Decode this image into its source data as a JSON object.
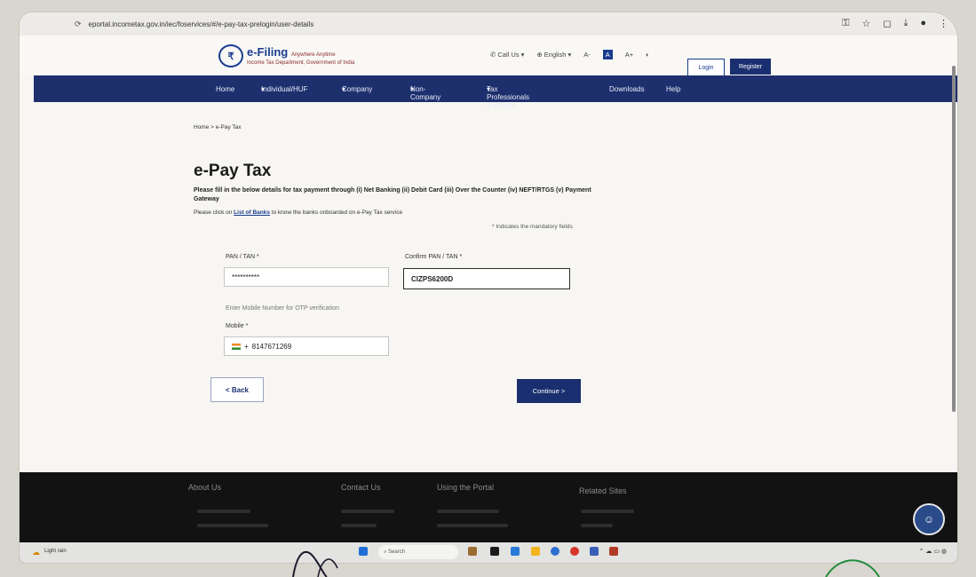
{
  "browser": {
    "url": "eportal.incometax.gov.in/iec/foservices/#/e-pay-tax-prelogin/user-details"
  },
  "header": {
    "logo_name": "e-Filing",
    "logo_tagline": "Anywhere Anytime",
    "logo_sub": "Income Tax Department, Government of India",
    "call_us": "Call Us",
    "language": "English",
    "font_small": "A-",
    "font_normal": "A",
    "font_large": "A+",
    "login": "Login",
    "register": "Register"
  },
  "nav": {
    "items": [
      "Home",
      "Individual/HUF",
      "Company",
      "Non-Company",
      "Tax Professionals & Others",
      "Downloads",
      "Help"
    ]
  },
  "breadcrumb": "Home  >  e-Pay Tax",
  "page": {
    "title": "e-Pay Tax",
    "description": "Please fill in the below details for tax payment through (i) Net Banking (ii) Debit Card (iii) Over the Counter (iv) NEFT/RTGS (v) Payment Gateway",
    "banks_prefix": "Please click on",
    "banks_link": "List of Banks",
    "banks_suffix": "to know the banks onboarded on e-Pay Tax service",
    "mandatory_note": "* Indicates the mandatory fields"
  },
  "form": {
    "pan_label": "PAN / TAN *",
    "pan_value": "**********",
    "confirm_label": "Confirm PAN / TAN *",
    "confirm_value": "CIZPS6200D",
    "mobile_hint": "Enter Mobile Number for OTP verification",
    "mobile_label": "Mobile *",
    "mobile_code": "+",
    "mobile_value": "8147671269",
    "back": "< Back",
    "continue": "Continue >"
  },
  "footer": {
    "columns": [
      "About Us",
      "Contact Us",
      "Using the Portal",
      "Related Sites"
    ]
  },
  "taskbar": {
    "search_placeholder": "Search",
    "weather": "Light rain"
  }
}
